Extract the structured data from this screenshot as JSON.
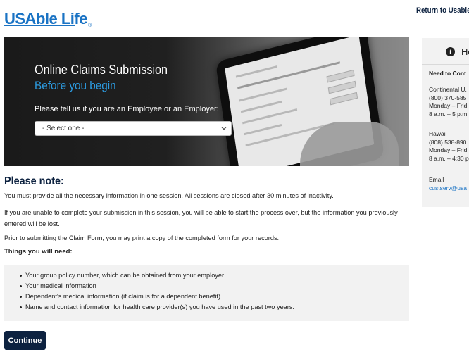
{
  "header": {
    "logo_text": "USAble Life",
    "return_link": "Return to Usableli"
  },
  "hero": {
    "title": "Online Claims Submission",
    "subtitle": "Before you begin",
    "prompt": "Please tell us if you are an Employee or an Employer:",
    "select_value": "- Select one -"
  },
  "notes": {
    "title": "Please note:",
    "p1": "You must provide all the necessary information in one session. All sessions are closed after 30 minutes of inactivity.",
    "p2": "If you are unable to complete your submission in this session, you will be able to start the process over, but the information you previously entered will be lost.",
    "p3": "Prior to submitting the Claim Form, you may print a copy of the completed form for your records.",
    "things_heading": "Things you will need:",
    "items": [
      "Your group policy number, which can be obtained from your employer",
      "Your medical information",
      "Dependent's medical information (if claim is for a dependent benefit)",
      "Name and contact information for health care provider(s) you have used in the past two years."
    ]
  },
  "continue_label": "Continue",
  "help": {
    "title": "He",
    "need_contact": "Need to Cont",
    "continental_title": "Continental U.",
    "continental_phone": "(800) 370-585",
    "continental_days": "Monday – Frid",
    "continental_hours": "8 a.m. – 5 p.m",
    "hawaii_title": "Hawaii",
    "hawaii_phone": "(808) 538-890",
    "hawaii_days": "Monday – Frid",
    "hawaii_hours": "8 a.m. – 4:30 p",
    "email_label": "Email",
    "email_value": "custserv@usa"
  },
  "colors": {
    "brand_blue": "#1a73c4",
    "navy": "#0d2240",
    "accent_blue": "#2c9be0",
    "panel_gray": "#f2f2f2"
  }
}
